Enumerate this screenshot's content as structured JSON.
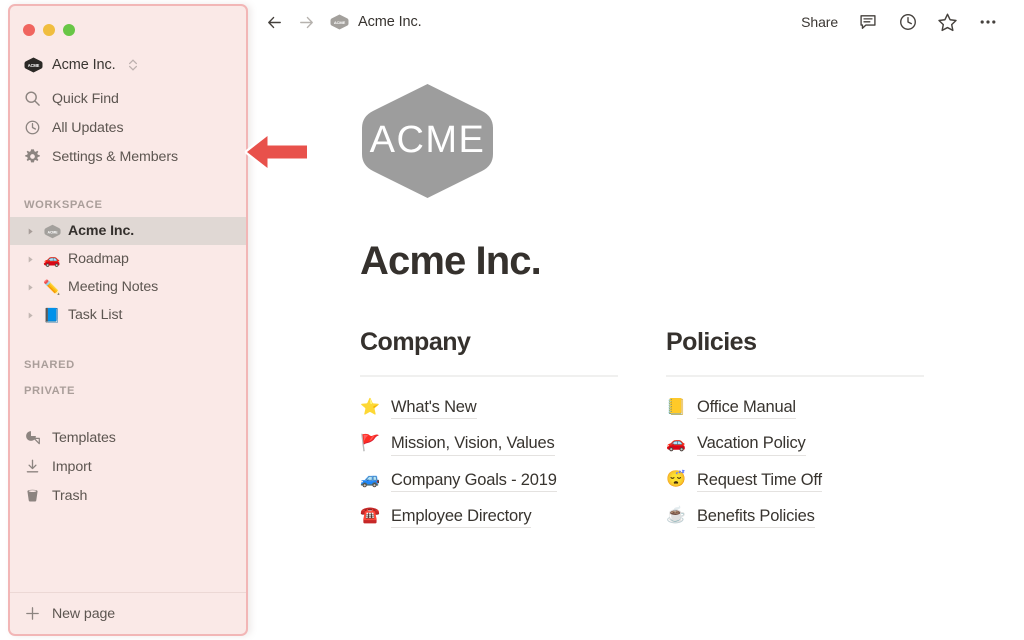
{
  "window": {
    "traffic_lights": [
      {
        "name": "close",
        "color": "#f0655f"
      },
      {
        "name": "minimize",
        "color": "#f0bd3f"
      },
      {
        "name": "maximize",
        "color": "#68c646"
      }
    ]
  },
  "sidebar": {
    "workspace_switcher": {
      "name": "Acme Inc.",
      "badge_text": "ACME",
      "chevron_icon": "chevron-up-down-icon"
    },
    "nav_items": [
      {
        "label": "Quick Find",
        "icon": "search-icon"
      },
      {
        "label": "All Updates",
        "icon": "clock-icon"
      },
      {
        "label": "Settings & Members",
        "icon": "gear-icon"
      }
    ],
    "sections": [
      {
        "label": "WORKSPACE"
      },
      {
        "label": "SHARED"
      },
      {
        "label": "PRIVATE"
      }
    ],
    "workspace_pages": [
      {
        "label": "Acme Inc.",
        "emoji": "",
        "badge": "ACME",
        "selected": true,
        "disclosure": "triangle-right-icon"
      },
      {
        "label": "Roadmap",
        "emoji": "🚗",
        "selected": false,
        "disclosure": "triangle-right-icon"
      },
      {
        "label": "Meeting Notes",
        "emoji": "✏️",
        "selected": false,
        "disclosure": "triangle-right-icon"
      },
      {
        "label": "Task List",
        "emoji": "📘",
        "selected": false,
        "disclosure": "triangle-right-icon"
      }
    ],
    "bottom_items": [
      {
        "label": "Templates",
        "icon": "templates-icon"
      },
      {
        "label": "Import",
        "icon": "download-icon"
      },
      {
        "label": "Trash",
        "icon": "trash-icon"
      }
    ],
    "new_page": {
      "label": "New page",
      "icon": "plus-icon"
    },
    "colors": {
      "background": "#fae9e7",
      "border": "#f2b6b6",
      "selected_row": "#e0d8d4"
    }
  },
  "topbar": {
    "back_icon": "arrow-left-icon",
    "forward_icon": "arrow-right-icon",
    "breadcrumb": {
      "badge_text": "ACME",
      "label": "Acme Inc."
    },
    "share_label": "Share",
    "actions": [
      {
        "name": "comment-icon"
      },
      {
        "name": "updates-clock-icon"
      },
      {
        "name": "favorite-star-icon"
      },
      {
        "name": "more-options-icon"
      }
    ]
  },
  "page": {
    "logo": {
      "text": "ACME",
      "shape": "hexagon",
      "color": "#9d9d9d"
    },
    "title": "Acme Inc.",
    "columns": [
      {
        "heading": "Company",
        "links": [
          {
            "emoji": "⭐",
            "label": "What's New"
          },
          {
            "emoji": "🚩",
            "label": "Mission, Vision, Values"
          },
          {
            "emoji": "🚙",
            "label": "Company Goals - 2019"
          },
          {
            "emoji": "☎️",
            "label": "Employee Directory"
          }
        ]
      },
      {
        "heading": "Policies",
        "links": [
          {
            "emoji": "📒",
            "label": "Office Manual"
          },
          {
            "emoji": "🚗",
            "label": "Vacation Policy"
          },
          {
            "emoji": "😴",
            "label": "Request Time Off"
          },
          {
            "emoji": "☕",
            "label": "Benefits Policies"
          }
        ]
      }
    ]
  },
  "annotation": {
    "arrow": {
      "name": "pointer-arrow-left",
      "color": "#e8514b",
      "points_to": "Settings & Members"
    }
  }
}
